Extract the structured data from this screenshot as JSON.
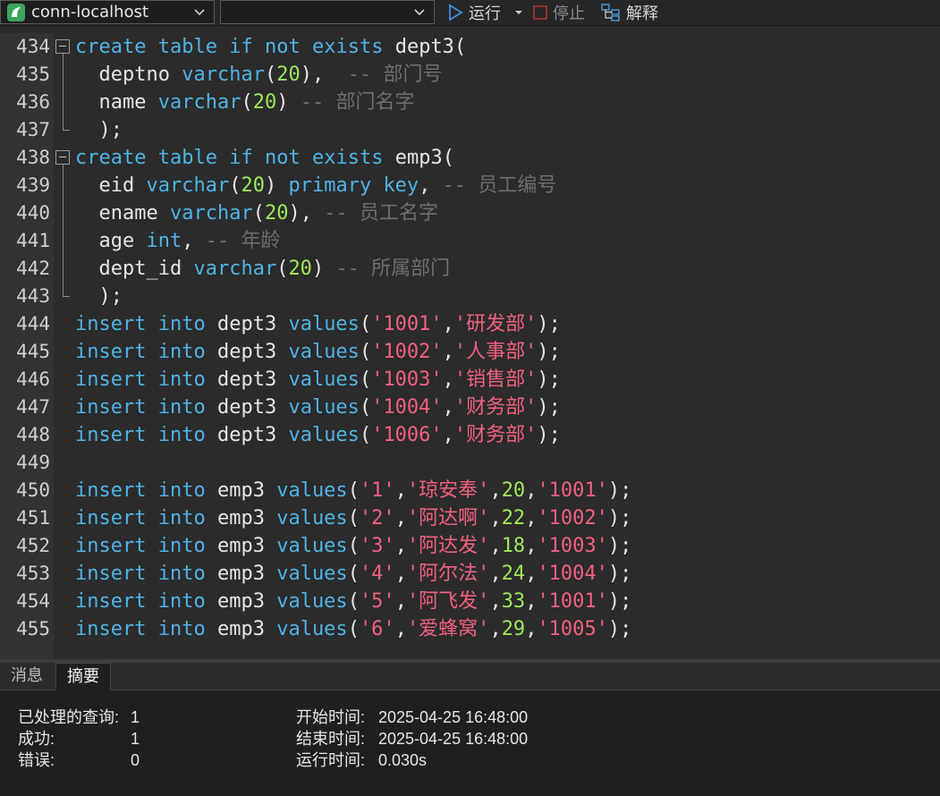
{
  "toolbar": {
    "connection": "conn-localhost",
    "database": "",
    "run_label": "运行",
    "stop_label": "停止",
    "explain_label": "解释"
  },
  "colors": {
    "keyword": "#4fb3e6",
    "string": "#f2607f",
    "number": "#9ee85a",
    "comment": "#6e6e6e",
    "identifier": "#e6e6e6"
  },
  "editor": {
    "lines": [
      {
        "num": "434",
        "text": "create table if not exists dept3("
      },
      {
        "num": "435",
        "text": "  deptno varchar(20),  -- 部门号"
      },
      {
        "num": "436",
        "text": "  name varchar(20) -- 部门名字"
      },
      {
        "num": "437",
        "text": "  );"
      },
      {
        "num": "438",
        "text": "create table if not exists emp3("
      },
      {
        "num": "439",
        "text": "  eid varchar(20) primary key, -- 员工编号"
      },
      {
        "num": "440",
        "text": "  ename varchar(20), -- 员工名字"
      },
      {
        "num": "441",
        "text": "  age int, -- 年龄"
      },
      {
        "num": "442",
        "text": "  dept_id varchar(20) -- 所属部门"
      },
      {
        "num": "443",
        "text": "  );"
      },
      {
        "num": "444",
        "text": "insert into dept3 values('1001','研发部');"
      },
      {
        "num": "445",
        "text": "insert into dept3 values('1002','人事部');"
      },
      {
        "num": "446",
        "text": "insert into dept3 values('1003','销售部');"
      },
      {
        "num": "447",
        "text": "insert into dept3 values('1004','财务部');"
      },
      {
        "num": "448",
        "text": "insert into dept3 values('1006','财务部');"
      },
      {
        "num": "449",
        "text": ""
      },
      {
        "num": "450",
        "text": "insert into emp3 values('1','琼安奉',20,'1001');"
      },
      {
        "num": "451",
        "text": "insert into emp3 values('2','阿达啊',22,'1002');"
      },
      {
        "num": "452",
        "text": "insert into emp3 values('3','阿达发',18,'1003');"
      },
      {
        "num": "453",
        "text": "insert into emp3 values('4','阿尔法',24,'1004');"
      },
      {
        "num": "454",
        "text": "insert into emp3 values('5','阿飞发',33,'1001');"
      },
      {
        "num": "455",
        "text": "insert into emp3 values('6','爱蜂窝',29,'1005');"
      }
    ]
  },
  "tabs": [
    {
      "label": "消息"
    },
    {
      "label": "摘要"
    }
  ],
  "summary": {
    "processed_label": "已处理的查询:",
    "processed_value": "1",
    "success_label": "成功:",
    "success_value": "1",
    "error_label": "错误:",
    "error_value": "0",
    "start_label": "开始时间:",
    "start_value": "2025-04-25 16:48:00",
    "end_label": "结束时间:",
    "end_value": "2025-04-25 16:48:00",
    "runtime_label": "运行时间:",
    "runtime_value": "0.030s"
  }
}
